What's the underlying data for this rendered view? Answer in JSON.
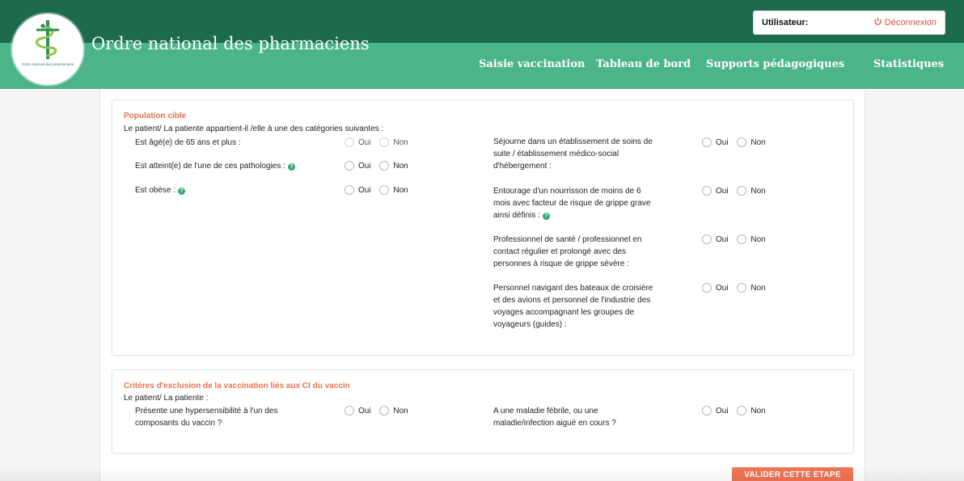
{
  "header": {
    "title": "Ordre national des pharmaciens",
    "logo_text": "Ordre national des pharmaciens",
    "user_label": "Utilisateur:",
    "logout_label": "Déconnexion",
    "logout_icon": "power-icon",
    "colors": {
      "top": "#1d6b4d",
      "band": "#4bb489",
      "accent": "#e0533d"
    }
  },
  "nav": {
    "items": [
      {
        "label": "Saisie vaccination"
      },
      {
        "label": "Tableau de bord"
      },
      {
        "label": "Supports pédagogiques"
      },
      {
        "label": "Statistiques"
      }
    ]
  },
  "options": {
    "yes": "Oui",
    "no": "Non"
  },
  "section1": {
    "title": "Population cible",
    "subtitle": "Le patient/ La patiente appartient-il /elle à une des catégories suivantes :",
    "left_questions": [
      {
        "text": "Est âgé(e) de 65 ans et plus :"
      },
      {
        "text": "Est atteint(e) de l'une de ces pathologies :"
      },
      {
        "text": "Est obèse :"
      }
    ],
    "right_questions": [
      {
        "line1": "Séjourne dans un établissement de soins de",
        "line2": "suite / établissement médico-social",
        "line3": "d'hébergement :"
      },
      {
        "line1": "Entourage d'un nourrisson de moins de 6",
        "line2": "mois avec facteur de risque de grippe grave",
        "line3": "ainsi définis :"
      },
      {
        "line1": "Professionnel de santé / professionnel en",
        "line2": "contact régulier et prolongé avec des",
        "line3": "personnes à risque de grippe sévère :"
      },
      {
        "line1": "Personnel navigant des bateaux de croisière",
        "line2": "et des avions et personnel de l'industrie des",
        "line3": "voyages accompagnant les groupes de",
        "line4": "voyageurs (guides) :"
      }
    ]
  },
  "section2": {
    "title": "Critères d'exclusion de la vaccination liés aux CI du vaccin",
    "subtitle": "Le patient/ La patiente :",
    "left_question": {
      "line1": "Présente une hypersensibilité à l'un des",
      "line2": "composants du vaccin ?"
    },
    "right_question": {
      "line1": "A une maladie fébrile, ou une",
      "line2": "maladie/infection aiguë en cours ?"
    }
  },
  "footer": {
    "validate_label": "VALIDER CETTE ETAPE"
  },
  "icons": {
    "help": "help-icon",
    "logo": "caduceus-icon"
  }
}
